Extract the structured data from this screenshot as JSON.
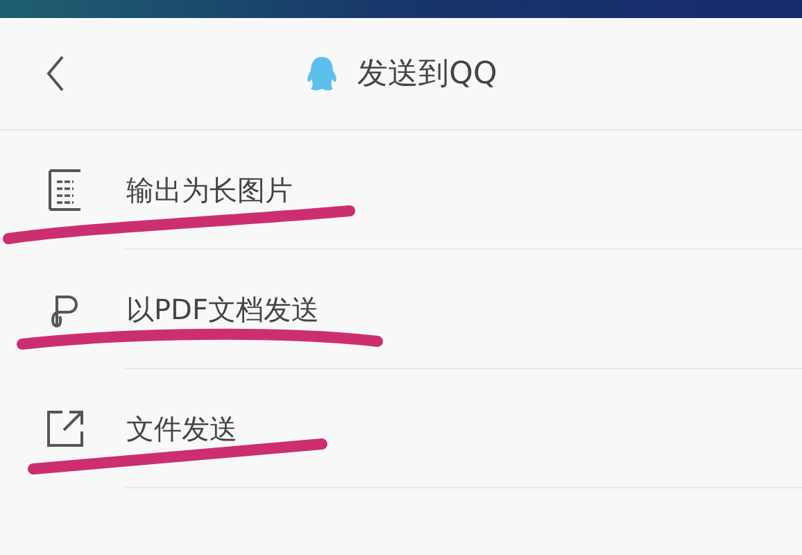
{
  "header": {
    "title": "发送到QQ"
  },
  "options": [
    {
      "kind": "long-image",
      "label": "输出为长图片",
      "underlined": true
    },
    {
      "kind": "pdf",
      "label": "以PDF文档发送",
      "underlined": true
    },
    {
      "kind": "file",
      "label": "文件发送",
      "underlined": true
    }
  ]
}
